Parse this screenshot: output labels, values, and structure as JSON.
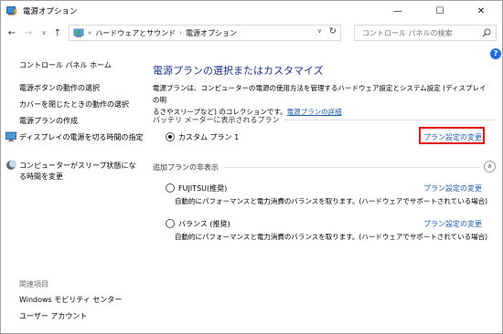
{
  "window": {
    "title": "電源オプション",
    "controls": {
      "minimize": "—",
      "maximize": "☐",
      "close": "✕"
    }
  },
  "nav": {
    "back": "←",
    "forward": "→",
    "recent": "∨",
    "up": "↑",
    "breadcrumb_prefix": "«",
    "breadcrumb": [
      "ハードウェアとサウンド",
      "電源オプション"
    ],
    "crumb_separator": "›",
    "dropdown": "∨",
    "refresh": "↻",
    "search_placeholder": "コントロール パネルの検索"
  },
  "sidebar": {
    "home": "コントロール パネル ホーム",
    "links": [
      "電源ボタンの動作の選択",
      "カバーを閉じたときの動作の選択",
      "電源プランの作成"
    ],
    "icon_links": [
      {
        "label": "ディスプレイの電源を切る時間の指定",
        "icon": "monitor-icon"
      },
      {
        "label_line1": "コンピューターがスリープ状態にな",
        "label_line2": "る時間を変更",
        "icon": "moon-icon"
      }
    ],
    "related_title": "関連項目",
    "related": [
      "Windows モビリティ センター",
      "ユーザー アカウント"
    ]
  },
  "main": {
    "help": "?",
    "title": "電源プランの選択またはカスタマイズ",
    "desc_line1": "電源プランは、コンピューターの電源の使用方法を管理するハードウェア設定とシステム設定 (ディスプレイの明",
    "desc_line2_prefix": "るさやスリープなど) のコレクションです。",
    "desc_link": "電源プランの詳細",
    "battery_section": "バッテリ メーターに表示されるプラン",
    "current_plan": {
      "name": "カスタム プラン 1",
      "link": "プラン設定の変更",
      "selected": true
    },
    "hidden_section": "追加プランの非表示",
    "collapse": "∧",
    "hidden_plans": [
      {
        "name": "FUJITSU(推奨)",
        "link": "プラン設定の変更",
        "desc": "自動的にパフォーマンスと電力消費のバランスを取ります。(ハードウェアでサポートされている場合)"
      },
      {
        "name": "バランス (推奨)",
        "link": "プラン設定の変更",
        "desc": "自動的にパフォーマンスと電力消費のバランスを取ります。(ハードウェアでサポートされている場合)"
      }
    ]
  },
  "colors": {
    "title_blue": "#1e3287",
    "link_blue": "#1e5ea8",
    "highlight_red": "#e01010"
  }
}
